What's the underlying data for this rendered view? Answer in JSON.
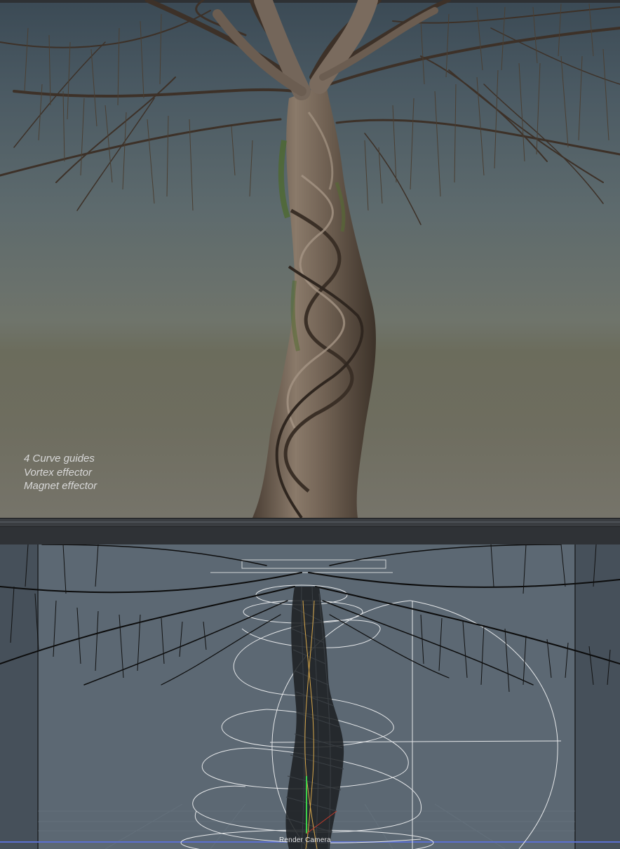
{
  "render_view": {
    "notes": [
      "4 Curve guides",
      "Vortex effector",
      "Magnet effector"
    ]
  },
  "viewport_3d": {
    "camera_label": "Render Camera"
  },
  "colors": {
    "sky_top": "#3b4a55",
    "horizon": "#6b6c5c",
    "viewport_bg": "#5c6873",
    "bark": "#6e5d4d",
    "wire_white": "#e6e8ea",
    "branch_black": "#0c0c0c"
  }
}
